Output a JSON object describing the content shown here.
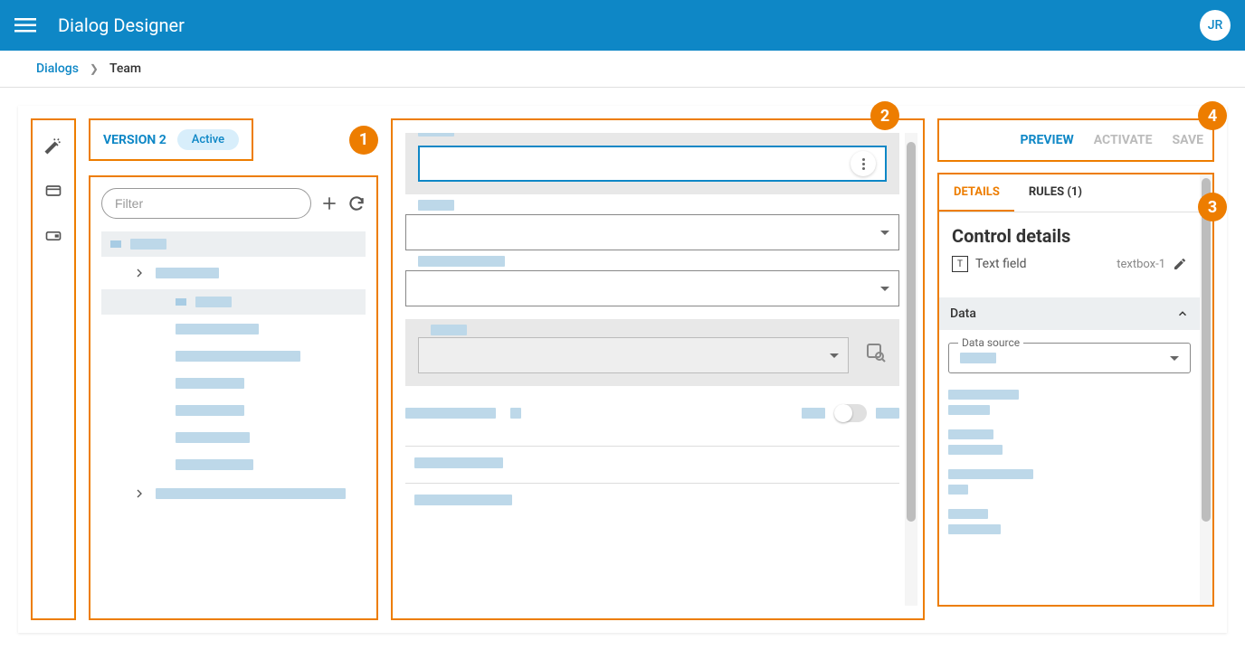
{
  "header": {
    "title": "Dialog Designer",
    "avatar": "JR"
  },
  "breadcrumb": {
    "root": "Dialogs",
    "current": "Team"
  },
  "version": {
    "label": "VERSION 2",
    "status": "Active"
  },
  "callouts": {
    "c1": "1",
    "c2": "2",
    "c3": "3",
    "c4": "4"
  },
  "filter": {
    "placeholder": "Filter"
  },
  "actions": {
    "preview": "PREVIEW",
    "activate": "ACTIVATE",
    "save": "SAVE"
  },
  "tabs": {
    "details": "DETAILS",
    "rules": "RULES (1)"
  },
  "details": {
    "title": "Control details",
    "control_type": "Text field",
    "control_id": "textbox-1",
    "accordion": "Data",
    "data_source_label": "Data source"
  }
}
